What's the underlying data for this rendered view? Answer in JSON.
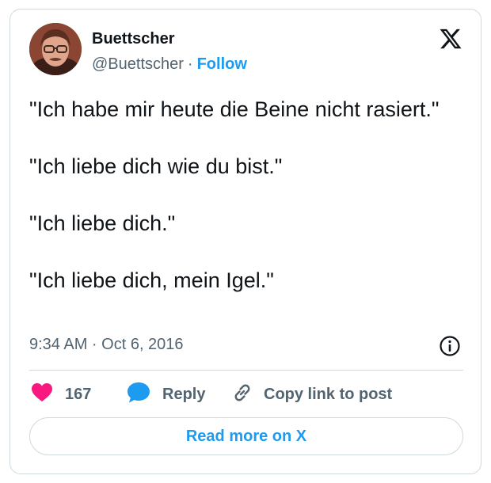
{
  "author": {
    "name": "Buettscher",
    "handle": "@Buettscher",
    "separator": "·",
    "follow_label": "Follow"
  },
  "tweet": {
    "paragraphs": [
      "\"Ich habe mir heute die Beine nicht rasiert.\"",
      "\"Ich liebe dich wie du bist.\"",
      "\"Ich liebe dich.\"",
      "\"Ich liebe dich, mein Igel.\""
    ],
    "timestamp": "9:34 AM · Oct 6, 2016"
  },
  "actions": {
    "like_count": "167",
    "reply_label": "Reply",
    "copy_label": "Copy link to post"
  },
  "read_more_label": "Read more on X",
  "icons": [
    "x-logo-icon",
    "info-icon",
    "heart-icon",
    "reply-bubble-icon",
    "link-icon"
  ],
  "colors": {
    "accent": "#1d9bf0",
    "like": "#f91880",
    "text": "#0f1419",
    "muted": "#536471",
    "border": "#cfd9de"
  }
}
